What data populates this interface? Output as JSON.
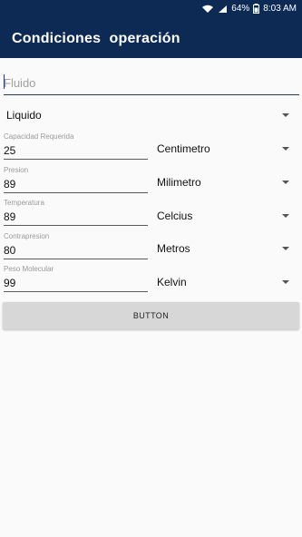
{
  "status_bar": {
    "battery": "64%",
    "time": "8:03 AM",
    "icons": [
      "wifi-icon",
      "signal-icon",
      "battery-icon"
    ]
  },
  "app_bar": {
    "title": "Condiciones  operación"
  },
  "fluid_field": {
    "placeholder": "Fluido",
    "value": ""
  },
  "fluid_type": {
    "selected": "Liquido"
  },
  "rows": [
    {
      "label": "Capacidad Requerida",
      "value": "25",
      "unit": "Centimetro"
    },
    {
      "label": "Presion",
      "value": "89",
      "unit": "Milimetro"
    },
    {
      "label": "Temperatura",
      "value": "89",
      "unit": "Celcius"
    },
    {
      "label": "Contrapresion",
      "value": "80",
      "unit": "Metros"
    },
    {
      "label": "Peso Molecular",
      "value": "99",
      "unit": "Kelvin"
    }
  ],
  "action_button": {
    "label": "BUTTON"
  },
  "colors": {
    "app_bar": "#0d2a55",
    "background": "#fafafa",
    "button": "#d7d7d7"
  }
}
